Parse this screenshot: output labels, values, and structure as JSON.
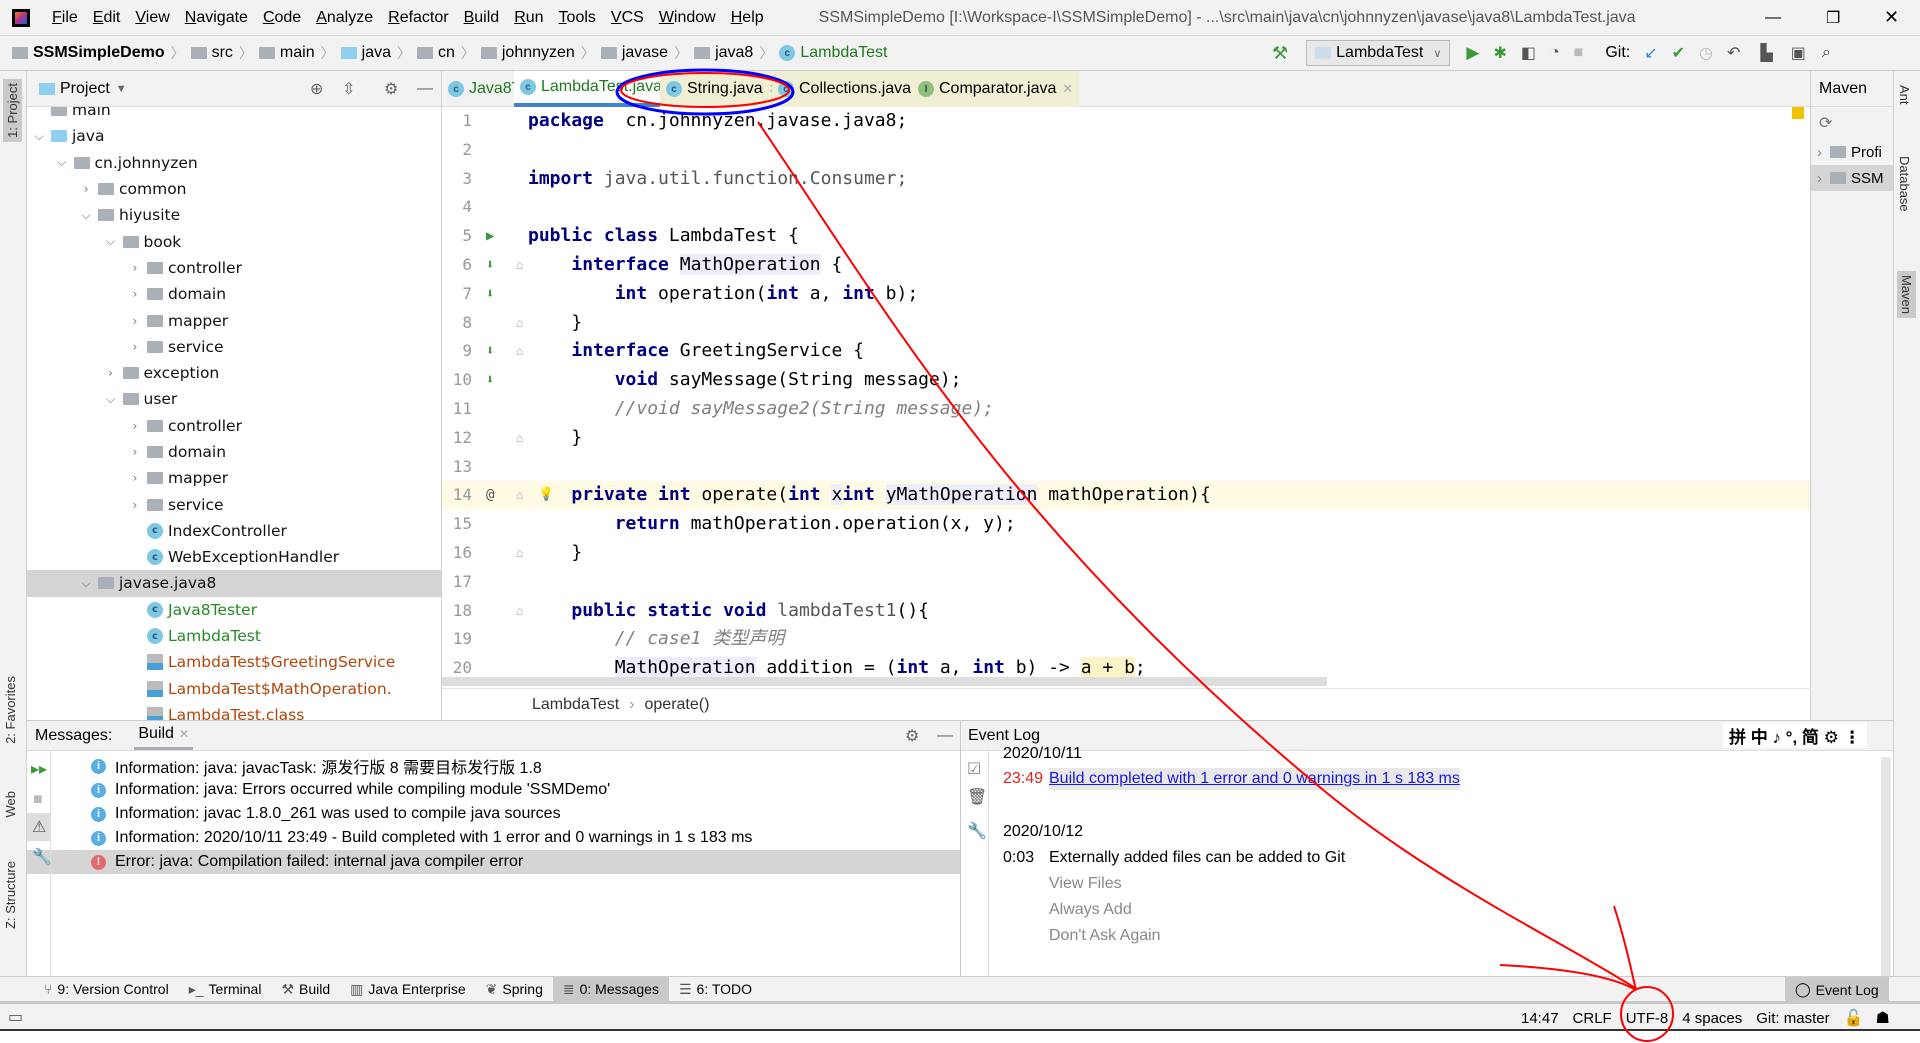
{
  "menubar": {
    "items": [
      "File",
      "Edit",
      "View",
      "Navigate",
      "Code",
      "Analyze",
      "Refactor",
      "Build",
      "Run",
      "Tools",
      "VCS",
      "Window",
      "Help"
    ],
    "title": "SSMSimpleDemo [I:\\Workspace-I\\SSMSimpleDemo] - ...\\src\\main\\java\\cn\\johnnyzen\\javase\\java8\\LambdaTest.java"
  },
  "navbar": {
    "breadcrumbs": [
      "SSMSimpleDemo",
      "src",
      "main",
      "java",
      "cn",
      "johnnyzen",
      "javase",
      "java8",
      "LambdaTest"
    ],
    "run_config": "LambdaTest",
    "git_label": "Git:"
  },
  "project": {
    "title": "Project",
    "tree": [
      {
        "label": "main",
        "level": 3,
        "arrow": "",
        "icon": "folder"
      },
      {
        "label": "java",
        "level": 4,
        "arrow": "down",
        "icon": "folder-blue"
      },
      {
        "label": "cn.johnnyzen",
        "level": 5,
        "arrow": "down",
        "icon": "folder"
      },
      {
        "label": "common",
        "level": 6,
        "arrow": "right",
        "icon": "folder"
      },
      {
        "label": "hiyusite",
        "level": 6,
        "arrow": "down",
        "icon": "folder"
      },
      {
        "label": "book",
        "level": 7,
        "arrow": "down",
        "icon": "folder"
      },
      {
        "label": "controller",
        "level": 8,
        "arrow": "right",
        "icon": "folder"
      },
      {
        "label": "domain",
        "level": 8,
        "arrow": "right",
        "icon": "folder"
      },
      {
        "label": "mapper",
        "level": 8,
        "arrow": "right",
        "icon": "folder"
      },
      {
        "label": "service",
        "level": 8,
        "arrow": "right",
        "icon": "folder"
      },
      {
        "label": "exception",
        "level": 7,
        "arrow": "right",
        "icon": "folder"
      },
      {
        "label": "user",
        "level": 7,
        "arrow": "down",
        "icon": "folder"
      },
      {
        "label": "controller",
        "level": 8,
        "arrow": "right",
        "icon": "folder"
      },
      {
        "label": "domain",
        "level": 8,
        "arrow": "right",
        "icon": "folder"
      },
      {
        "label": "mapper",
        "level": 8,
        "arrow": "right",
        "icon": "folder"
      },
      {
        "label": "service",
        "level": 8,
        "arrow": "right",
        "icon": "folder"
      },
      {
        "label": "IndexController",
        "level": 8,
        "arrow": "",
        "icon": "class"
      },
      {
        "label": "WebExceptionHandler",
        "level": 8,
        "arrow": "",
        "icon": "class"
      },
      {
        "label": "javase.java8",
        "level": 6,
        "arrow": "down",
        "icon": "folder",
        "selected": true
      },
      {
        "label": "Java8Tester",
        "level": 8,
        "arrow": "",
        "icon": "class",
        "color": "green"
      },
      {
        "label": "LambdaTest",
        "level": 8,
        "arrow": "",
        "icon": "class",
        "color": "green"
      },
      {
        "label": "LambdaTest$GreetingService",
        "level": 8,
        "arrow": "",
        "icon": "binary",
        "color": "brown"
      },
      {
        "label": "LambdaTest$MathOperation.",
        "level": 8,
        "arrow": "",
        "icon": "binary",
        "color": "brown"
      },
      {
        "label": "LambdaTest.class",
        "level": 8,
        "arrow": "",
        "icon": "binary",
        "color": "brown"
      }
    ]
  },
  "editor": {
    "tabs": [
      {
        "label": "Java8Tester.java",
        "icon": "class",
        "kind": "g"
      },
      {
        "label": "LambdaTest.java",
        "icon": "class",
        "kind": "active"
      },
      {
        "label": "String.java",
        "icon": "class",
        "kind": "ext"
      },
      {
        "label": "Collections.java",
        "icon": "class",
        "kind": "ext"
      },
      {
        "label": "Comparator.java",
        "icon": "interface",
        "kind": "ext"
      }
    ],
    "lines": [
      [
        [
          "kw",
          "package"
        ],
        [
          "",
          "  cn.johnnyzen.javase.java8;"
        ]
      ],
      [],
      [
        [
          "kw",
          "import"
        ],
        [
          "cm0",
          " java.util.function.Consumer;"
        ]
      ],
      [],
      [
        [
          "kw",
          "public class"
        ],
        [
          "",
          " LambdaTest {"
        ]
      ],
      [
        [
          "",
          "    "
        ],
        [
          "kw",
          "interface"
        ],
        [
          "",
          " "
        ],
        [
          "tp",
          "MathOperation"
        ],
        [
          "",
          " {"
        ]
      ],
      [
        [
          "",
          "        "
        ],
        [
          "kw",
          "int"
        ],
        [
          "",
          " operation("
        ],
        [
          "kw",
          "int"
        ],
        [
          "",
          " a, "
        ],
        [
          "kw",
          "int"
        ],
        [
          "",
          " b);"
        ]
      ],
      [
        [
          "",
          "    }"
        ]
      ],
      [
        [
          "",
          "    "
        ],
        [
          "kw",
          "interface"
        ],
        [
          "",
          " GreetingService {"
        ]
      ],
      [
        [
          "",
          "        "
        ],
        [
          "kw",
          "void"
        ],
        [
          "",
          " sayMessage(String message);"
        ]
      ],
      [
        [
          "",
          "        "
        ],
        [
          "cm",
          "//void sayMessage2(String message);"
        ]
      ],
      [
        [
          "",
          "    }"
        ]
      ],
      [],
      [
        [
          "",
          "    "
        ],
        [
          "kw",
          "private int"
        ],
        [
          "",
          " operate("
        ],
        [
          "kw",
          "int"
        ],
        [
          "",
          " "
        ],
        [
          "tp",
          "x"
        ],
        [
          ", "
        ],
        [
          "kw",
          "int"
        ],
        [
          "",
          " "
        ],
        [
          "tp",
          "y"
        ],
        [
          ", "
        ],
        [
          "tp",
          "MathOperation"
        ],
        [
          "",
          " mathOperation){"
        ]
      ],
      [
        [
          "",
          "        "
        ],
        [
          "kw",
          "return"
        ],
        [
          "",
          " mathOperation.operation(x, y);"
        ]
      ],
      [
        [
          "",
          "    }"
        ]
      ],
      [],
      [
        [
          "",
          "    "
        ],
        [
          "kw",
          "public static void"
        ],
        [
          "cm0",
          " lambdaTest1"
        ],
        [
          "",
          "(){"
        ]
      ],
      [
        [
          "",
          "        "
        ],
        [
          "cm",
          "// case1 类型声明"
        ]
      ],
      [
        [
          "",
          "        "
        ],
        [
          "tp",
          "MathOperation"
        ],
        [
          "",
          " addition = ("
        ],
        [
          "kw",
          "int"
        ],
        [
          "",
          " a, "
        ],
        [
          "kw",
          "int"
        ],
        [
          "",
          " b) -> "
        ],
        [
          "hl",
          "a + b"
        ],
        [
          "",
          ";"
        ]
      ]
    ],
    "gutter": {
      "5": "run",
      "6": "impl",
      "7": "impl",
      "9": "impl",
      "10": "impl",
      "14": "@"
    },
    "current_line": 14,
    "breadcrumb": [
      "LambdaTest",
      "operate()"
    ]
  },
  "maven": {
    "title": "Maven",
    "items": [
      "Profi",
      "SSM"
    ]
  },
  "left_stripe": [
    "1: Project",
    "2: Favorites",
    "Web",
    "Z: Structure"
  ],
  "right_stripe": [
    "Ant",
    "Database",
    "Maven"
  ],
  "messages": {
    "title": "Messages:",
    "tab": "Build",
    "items": [
      {
        "type": "info",
        "text": "Information: java: javacTask: 源发行版 8 需要目标发行版 1.8"
      },
      {
        "type": "info",
        "text": "Information: java: Errors occurred while compiling module 'SSMDemo'"
      },
      {
        "type": "info",
        "text": "Information: javac 1.8.0_261 was used to compile java sources"
      },
      {
        "type": "info",
        "text": "Information: 2020/10/11 23:49 - Build completed with 1 error and 0 warnings in 1 s 183 ms"
      },
      {
        "type": "error",
        "text": "Error: java: Compilation failed: internal java compiler error"
      }
    ]
  },
  "eventlog": {
    "title": "Event Log",
    "date1": "2020/10/11",
    "time1": "23:49",
    "link1": "Build completed with 1 error and 0 warnings in 1 s 183 ms",
    "date2": "2020/10/12",
    "time2": "0:03",
    "msg2": "Externally added files can be added to Git",
    "actions": [
      "View Files",
      "Always Add",
      "Don't Ask Again"
    ],
    "ime": "拼 中 ♪ °, 简 ⚙ ⋮"
  },
  "bottombar": {
    "items": [
      "9: Version Control",
      "Terminal",
      "Build",
      "Java Enterprise",
      "Spring",
      "0: Messages",
      "6: TODO"
    ],
    "active": "0: Messages",
    "event_log": "Event Log"
  },
  "statusbar": {
    "position": "14:47",
    "line_sep": "CRLF",
    "encoding": "UTF-8",
    "indent": "4 spaces",
    "git": "Git: master"
  },
  "colors": {
    "accent": "#4083c9",
    "annotation": "#ff0000",
    "annotation_blue": "#0000ff",
    "error": "#e36a6a",
    "link": "#0000ee"
  }
}
